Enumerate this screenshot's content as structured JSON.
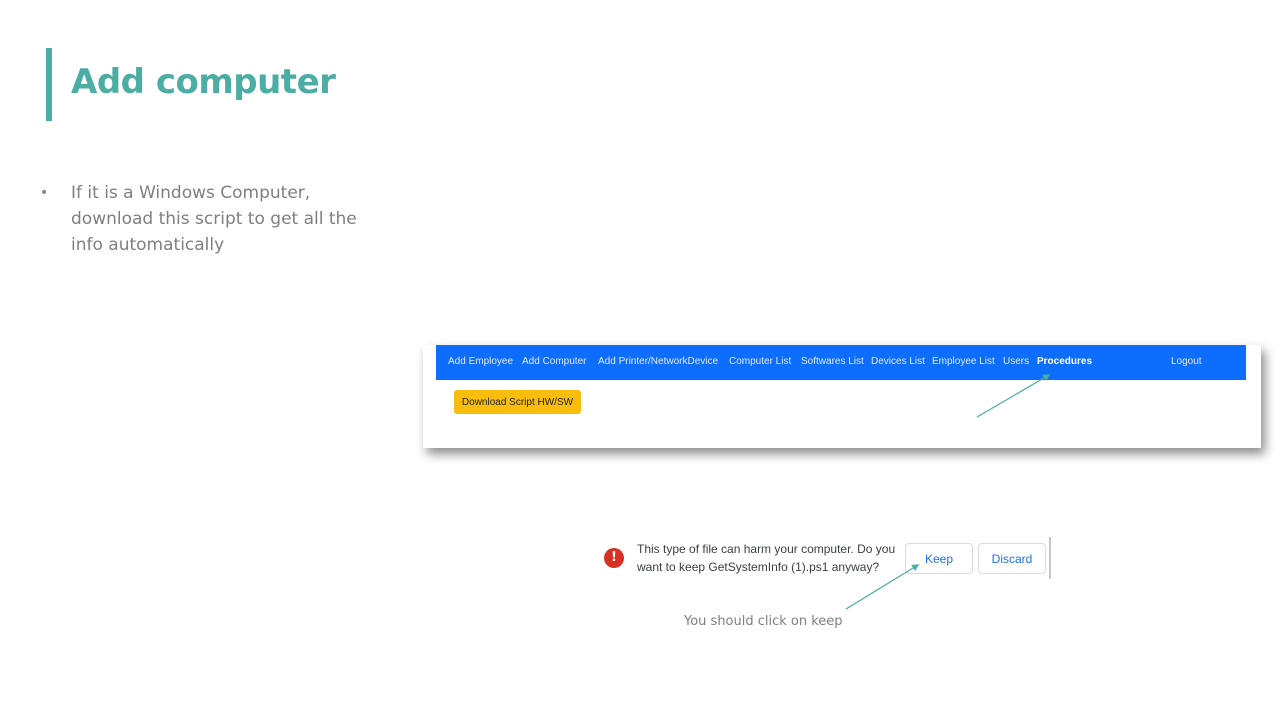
{
  "slide": {
    "title": "Add computer",
    "bullets": [
      "If it is a Windows Computer, download this script to get all the info automatically"
    ],
    "caption": "You should click on keep"
  },
  "navbar": {
    "items": [
      {
        "label": "Add Employee"
      },
      {
        "label": "Add Computer"
      },
      {
        "label": "Add Printer/NetworkDevice"
      },
      {
        "label": "Computer List"
      },
      {
        "label": "Softwares List"
      },
      {
        "label": "Devices List"
      },
      {
        "label": "Employee List"
      },
      {
        "label": "Users"
      },
      {
        "label": "Procedures"
      }
    ],
    "active": "Procedures",
    "logout": "Logout"
  },
  "page": {
    "download_button": "Download Script HW/SW"
  },
  "download_warning": {
    "icon": "!",
    "message": "This type of file can harm your computer. Do you want to keep GetSystemInfo (1).ps1 anyway?",
    "keep": "Keep",
    "discard": "Discard"
  },
  "colors": {
    "accent": "#4bada3",
    "navbar": "#0d6efd",
    "download_button": "#f9be0d",
    "warning_icon": "#d93025",
    "link_blue": "#1a73e8"
  }
}
